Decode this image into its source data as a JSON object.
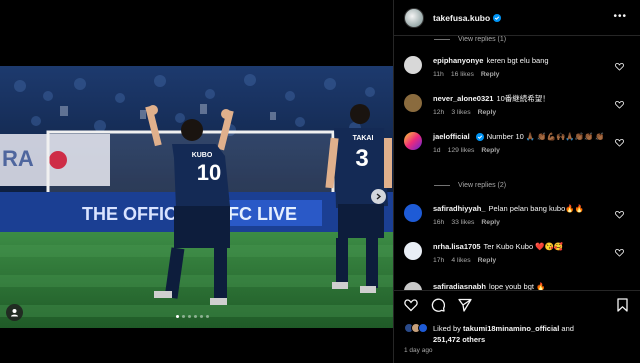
{
  "post": {
    "username": "takefusa.kubo",
    "more_label": "•••",
    "view_replies_top": "View replies (1)"
  },
  "comments": [
    {
      "username": "epiphanyonye",
      "text": "keren bgt elu bang",
      "time": "11h",
      "likes": "16 likes",
      "reply": "Reply",
      "verified": false
    },
    {
      "username": "never_alone0321",
      "text": "10番継続希望！",
      "time": "12h",
      "likes": "3 likes",
      "reply": "Reply",
      "verified": false
    },
    {
      "username": "jaelofficial",
      "text": "Number 10 🙏🏾 👏🏾💪🏾🙌🏾🙏🏾👏🏾👏🏾 👏🏾",
      "time": "1d",
      "likes": "129 likes",
      "reply": "Reply",
      "verified": true,
      "view_replies": "View replies (2)"
    },
    {
      "username": "safiradhiyyah_",
      "text": "Pelan pelan bang kubo🔥🔥",
      "time": "16h",
      "likes": "33 likes",
      "reply": "Reply",
      "verified": false
    },
    {
      "username": "nrha.lisa1705",
      "text": "Ter Kubo Kubo ❤️😘🥰",
      "time": "17h",
      "likes": "4 likes",
      "reply": "Reply",
      "verified": false
    },
    {
      "username": "safiradiasnabh",
      "text": "lope youb bgt 🔥",
      "time": "",
      "likes": "",
      "reply": "",
      "verified": false
    }
  ],
  "footer": {
    "liked_prefix": "Liked by",
    "liked_user": "takumi18minamino_official",
    "liked_and": "and",
    "liked_count": "251,472 others",
    "time_ago": "1 day ago"
  },
  "photo": {
    "banner_text": "THE OFFICIAL",
    "banner_text_2": "FC LIVE",
    "player_left_name": "KUBO",
    "player_left_number": "10",
    "player_right_name": "TAKAI",
    "player_right_number": "3"
  },
  "colors": {
    "background": "#000000",
    "accent_blue": "#0095f6",
    "muted_text": "#a8a8a8",
    "jersey_navy": "#142a55",
    "pitch_green": "#2f7a3a"
  }
}
